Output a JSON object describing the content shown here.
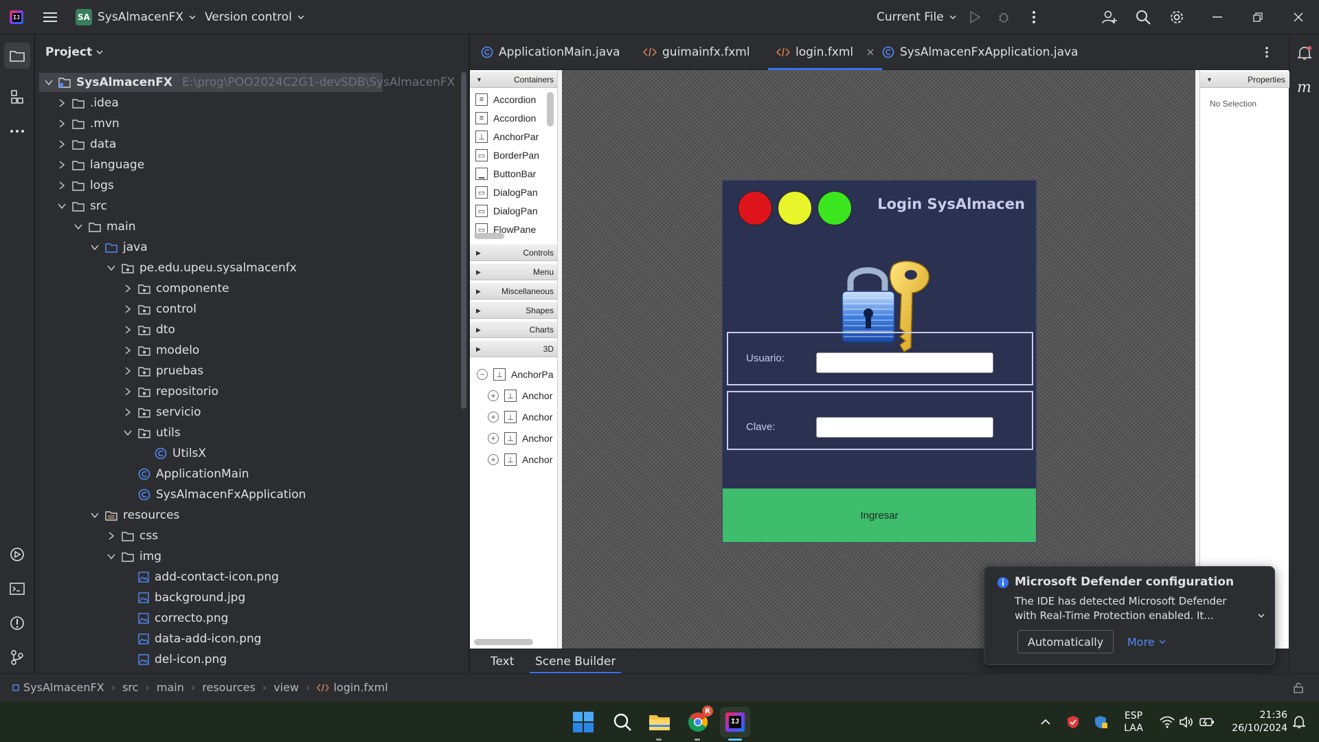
{
  "titlebar": {
    "project_badge": "SA",
    "project_name": "SysAlmacenFX",
    "vcs": "Version control",
    "run_config": "Current File"
  },
  "project_panel": {
    "title": "Project",
    "tree": [
      {
        "label": "SysAlmacenFX",
        "path": "E:\\prog\\POO2024C2G1-devSDB\\SysAlmacenFX",
        "depth": 0,
        "kind": "module",
        "expanded": true
      },
      {
        "label": ".idea",
        "depth": 1,
        "kind": "folder",
        "expanded": false
      },
      {
        "label": ".mvn",
        "depth": 1,
        "kind": "folder",
        "expanded": false
      },
      {
        "label": "data",
        "depth": 1,
        "kind": "folder",
        "expanded": false
      },
      {
        "label": "language",
        "depth": 1,
        "kind": "folder",
        "expanded": false
      },
      {
        "label": "logs",
        "depth": 1,
        "kind": "folder",
        "expanded": false
      },
      {
        "label": "src",
        "depth": 1,
        "kind": "folder",
        "expanded": true
      },
      {
        "label": "main",
        "depth": 2,
        "kind": "folder",
        "expanded": true
      },
      {
        "label": "java",
        "depth": 3,
        "kind": "source-folder",
        "expanded": true
      },
      {
        "label": "pe.edu.upeu.sysalmacenfx",
        "depth": 4,
        "kind": "package",
        "expanded": true
      },
      {
        "label": "componente",
        "depth": 5,
        "kind": "package",
        "expanded": false
      },
      {
        "label": "control",
        "depth": 5,
        "kind": "package",
        "expanded": false
      },
      {
        "label": "dto",
        "depth": 5,
        "kind": "package",
        "expanded": false
      },
      {
        "label": "modelo",
        "depth": 5,
        "kind": "package",
        "expanded": false
      },
      {
        "label": "pruebas",
        "depth": 5,
        "kind": "package",
        "expanded": false
      },
      {
        "label": "repositorio",
        "depth": 5,
        "kind": "package",
        "expanded": false
      },
      {
        "label": "servicio",
        "depth": 5,
        "kind": "package",
        "expanded": false
      },
      {
        "label": "utils",
        "depth": 5,
        "kind": "package",
        "expanded": true
      },
      {
        "label": "UtilsX",
        "depth": 6,
        "kind": "class"
      },
      {
        "label": "ApplicationMain",
        "depth": 5,
        "kind": "class"
      },
      {
        "label": "SysAlmacenFxApplication",
        "depth": 5,
        "kind": "class"
      },
      {
        "label": "resources",
        "depth": 3,
        "kind": "resources-folder",
        "expanded": true
      },
      {
        "label": "css",
        "depth": 4,
        "kind": "folder",
        "expanded": false
      },
      {
        "label": "img",
        "depth": 4,
        "kind": "folder",
        "expanded": true
      },
      {
        "label": "add-contact-icon.png",
        "depth": 5,
        "kind": "image"
      },
      {
        "label": "background.jpg",
        "depth": 5,
        "kind": "image"
      },
      {
        "label": "correcto.png",
        "depth": 5,
        "kind": "image"
      },
      {
        "label": "data-add-icon.png",
        "depth": 5,
        "kind": "image"
      },
      {
        "label": "del-icon.png",
        "depth": 5,
        "kind": "image"
      }
    ]
  },
  "editor_tabs": [
    {
      "label": "ApplicationMain.java",
      "icon": "java-class-icon"
    },
    {
      "label": "guimainfx.fxml",
      "icon": "xml-icon"
    },
    {
      "label": "login.fxml",
      "icon": "xml-icon",
      "active": true
    },
    {
      "label": "SysAlmacenFxApplication.java",
      "icon": "java-class-icon"
    }
  ],
  "scene_builder": {
    "library_sections": [
      "Containers",
      "Controls",
      "Menu",
      "Miscellaneous",
      "Shapes",
      "Charts",
      "3D"
    ],
    "containers": [
      "Accordion",
      "Accordion",
      "AnchorPar",
      "BorderPan",
      "ButtonBar",
      "DialogPan",
      "DialogPan",
      "FlowPane"
    ],
    "hierarchy": [
      {
        "label": "AnchorPa",
        "expanded": true
      },
      {
        "label": "Anchor"
      },
      {
        "label": "Anchor"
      },
      {
        "label": "Anchor"
      },
      {
        "label": "Anchor"
      }
    ],
    "properties_title": "Properties",
    "properties_empty": "No Selection",
    "login": {
      "title": "Login SysAlmacen",
      "traffic_lights": [
        "#e0151b",
        "#e8f52b",
        "#3ce61f"
      ],
      "usuario_label": "Usuario:",
      "clave_label": "Clave:",
      "button": "Ingresar",
      "bg_color": "#2b3151",
      "button_color": "#3ebd6d"
    }
  },
  "bottom_tabs": [
    {
      "label": "Text"
    },
    {
      "label": "Scene Builder",
      "active": true
    }
  ],
  "notification": {
    "title": "Microsoft Defender configuration",
    "body": "The IDE has detected Microsoft Defender with Real-Time Protection enabled. It...",
    "primary_action": "Automatically",
    "secondary_action": "More"
  },
  "breadcrumb": [
    "SysAlmacenFX",
    "src",
    "main",
    "resources",
    "view",
    "login.fxml"
  ],
  "taskbar": {
    "lang": "ESP",
    "layout": "LAA",
    "time": "21:36",
    "date": "26/10/2024",
    "chrome_badge": "R"
  }
}
